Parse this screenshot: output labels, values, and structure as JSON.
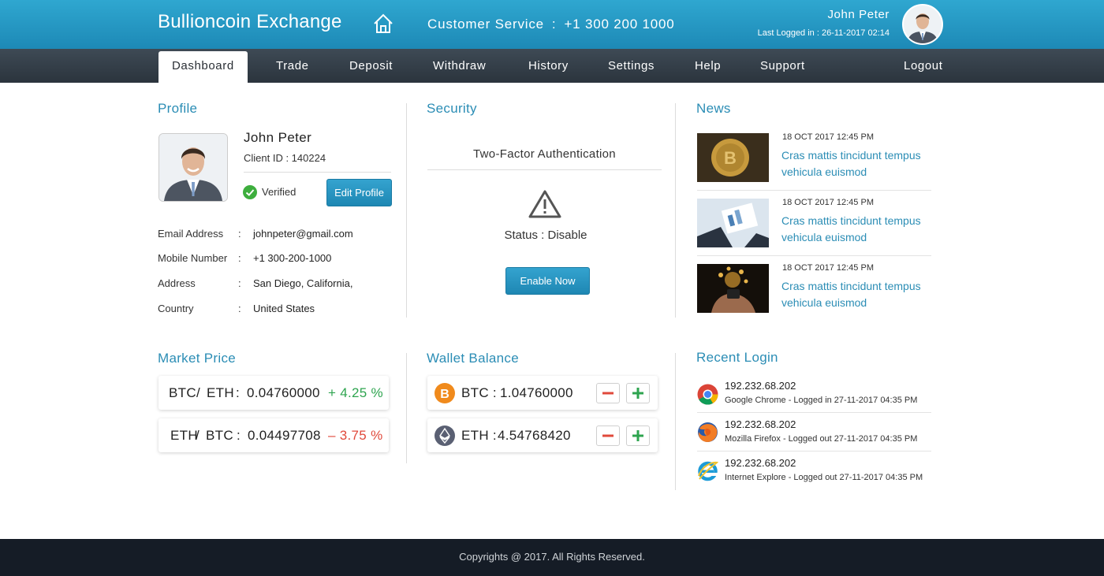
{
  "header": {
    "brand": "Bullioncoin Exchange",
    "customer_service_label": "Customer Service",
    "customer_service_sep": ":",
    "customer_service_phone": "+1  300 200 1000",
    "user_name": "John Peter",
    "last_login": "Last Logged in : 26-11-2017 02:14"
  },
  "nav": {
    "items": [
      "Dashboard",
      "Trade",
      "Deposit",
      "Withdraw",
      "History",
      "Settings",
      "Help",
      "Support"
    ],
    "logout": "Logout",
    "active": "Dashboard"
  },
  "profile": {
    "title": "Profile",
    "name": "John Peter",
    "client_id": "Client ID  :  140224",
    "verified": "Verified",
    "edit_button": "Edit Profile",
    "fields": [
      {
        "label": "Email Address",
        "colon": ":",
        "value": "johnpeter@gmail.com"
      },
      {
        "label": "Mobile Number",
        "colon": ":",
        "value": "+1 300-200-1000"
      },
      {
        "label": "Address",
        "colon": ":",
        "value": "San Diego, California,"
      },
      {
        "label": "Country",
        "colon": ":",
        "value": "United States"
      }
    ]
  },
  "security": {
    "title": "Security",
    "tfa_label": "Two-Factor Authentication",
    "status": "Status  :  Disable",
    "enable_button": "Enable Now"
  },
  "news": {
    "title": "News",
    "items": [
      {
        "date": "18 OCT 2017   12:45 PM",
        "headline": "Cras mattis tincidunt tempus vehicula euismod"
      },
      {
        "date": "18 OCT 2017   12:45 PM",
        "headline": "Cras mattis tincidunt tempus vehicula euismod"
      },
      {
        "date": "18 OCT 2017   12:45 PM",
        "headline": "Cras mattis tincidunt tempus vehicula euismod"
      }
    ]
  },
  "market": {
    "title": "Market Price",
    "rows": [
      {
        "base": "BTC",
        "slash": "/",
        "quote": "ETH",
        "colon": ":",
        "price": "0.04760000",
        "change": "+ 4.25 %",
        "direction": "up"
      },
      {
        "base": "ETH",
        "slash": "/",
        "quote": "BTC",
        "colon": ":",
        "price": "0.04497708",
        "change": "– 3.75 %",
        "direction": "down"
      }
    ]
  },
  "wallet": {
    "title": "Wallet Balance",
    "rows": [
      {
        "coin": "BTC :",
        "amount": "1.04760000",
        "icon": "bitcoin-icon"
      },
      {
        "coin": "ETH :",
        "amount": "4.54768420",
        "icon": "ethereum-icon"
      }
    ]
  },
  "recent_login": {
    "title": "Recent Login",
    "items": [
      {
        "ip": "192.232.68.202",
        "desc": "Google Chrome - Logged in 27-11-2017 04:35 PM",
        "browser": "chrome-icon"
      },
      {
        "ip": "192.232.68.202",
        "desc": "Mozilla Firefox - Logged out 27-11-2017 04:35 PM",
        "browser": "firefox-icon"
      },
      {
        "ip": "192.232.68.202",
        "desc": "Internet Explore - Logged out 27-11-2017 04:35 PM",
        "browser": "internet-explorer-icon"
      }
    ]
  },
  "colors": {
    "accent": "#2b8db5",
    "header": "#2fa7d0",
    "nav": "#333d47",
    "positive": "#2ea44f",
    "negative": "#e0493b",
    "footer": "#151c26"
  },
  "footer": {
    "text": "Copyrights @ 2017. All Rights Reserved."
  }
}
